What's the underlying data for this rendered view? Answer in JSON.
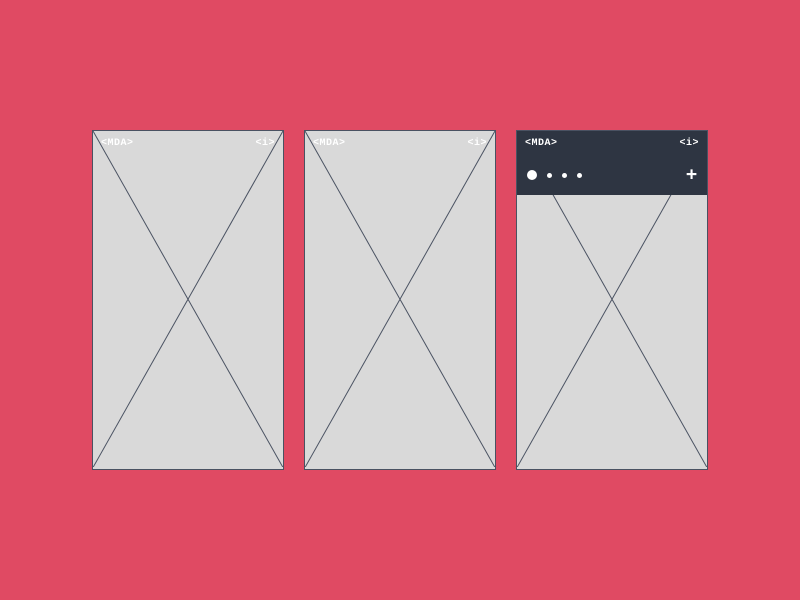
{
  "frames": [
    {
      "logo": "<MDA>",
      "info": "<i>",
      "header_style": "transparent",
      "has_toolbar": false
    },
    {
      "logo": "<MDA>",
      "info": "<i>",
      "header_style": "transparent",
      "has_toolbar": false
    },
    {
      "logo": "<MDA>",
      "info": "<i>",
      "header_style": "dark",
      "has_toolbar": true
    }
  ],
  "toolbar": {
    "add_label": "+"
  },
  "colors": {
    "background": "#e04a63",
    "frame_bg": "#d9d9d9",
    "dark_header": "#2e3542",
    "line": "#4a5262"
  }
}
